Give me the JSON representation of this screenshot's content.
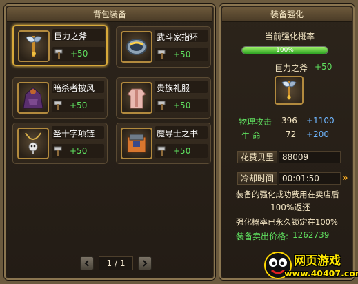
{
  "left_panel": {
    "title": "背包装备",
    "items": [
      {
        "name": "巨力之斧",
        "bonus": "+50",
        "icon": "axe-icon",
        "selected": true
      },
      {
        "name": "武斗家指环",
        "bonus": "+50",
        "icon": "ring-icon",
        "selected": false
      },
      {
        "name": "暗杀者披风",
        "bonus": "+50",
        "icon": "cloak-icon",
        "selected": false
      },
      {
        "name": "贵族礼服",
        "bonus": "+50",
        "icon": "robe-icon",
        "selected": false
      },
      {
        "name": "圣十字项链",
        "bonus": "+50",
        "icon": "necklace-icon",
        "selected": false
      },
      {
        "name": "魔导士之书",
        "bonus": "+50",
        "icon": "book-icon",
        "selected": false
      }
    ],
    "pager": {
      "page": "1 / 1"
    }
  },
  "right_panel": {
    "title": "装备强化",
    "rate_label": "当前强化概率",
    "rate_value": "100%",
    "rate_fraction": 1.0,
    "item_name": "巨力之斧",
    "item_bonus": "+50",
    "attack_label": "物理攻击",
    "attack_value": "396",
    "attack_bonus": "+1100",
    "life_label": "生  命",
    "life_value": "72",
    "life_bonus": "+200",
    "cost_label": "花费贝里",
    "cost_value": "88009",
    "cooldown_label": "冷却时间",
    "cooldown_value": "00:01:50",
    "note_line1": "装备的强化成功费用在卖店后",
    "note_line2": "100%返还",
    "lock_note": "强化概率已永久锁定在100%",
    "sell_label": "装备卖出价格:",
    "sell_value": "1262739"
  },
  "watermark": {
    "brand": "网页游戏",
    "url": "www.40407.com"
  },
  "colors": {
    "green": "#5fe05f",
    "blue": "#6fb6ff",
    "gold": "#d7a93a"
  }
}
